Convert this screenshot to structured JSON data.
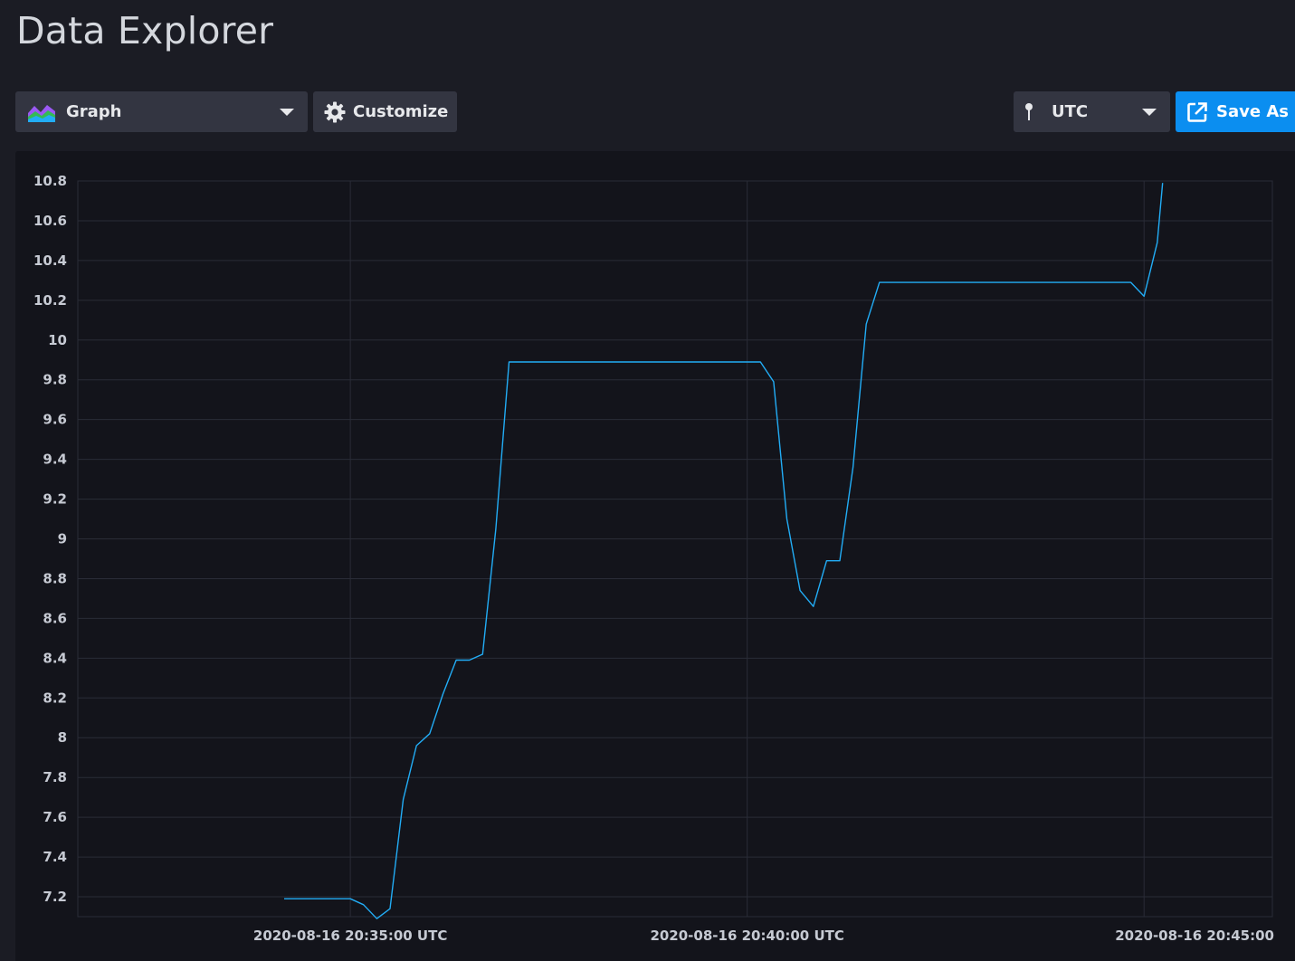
{
  "header": {
    "title": "Data Explorer"
  },
  "toolbar": {
    "visualization_label": "Graph",
    "visualization_icon": "graph-icon",
    "customize_label": "Customize",
    "customize_icon": "gear-icon",
    "timezone_label": "UTC",
    "timezone_icon": "pin-icon",
    "save_label": "Save As",
    "save_icon": "external-link-icon"
  },
  "colors": {
    "background": "#1b1c24",
    "panel": "#13141b",
    "button": "#333541",
    "accent": "#0b8ef0",
    "series": "#22adf6",
    "grid": "#2a2c37"
  },
  "chart_data": {
    "type": "line",
    "title": "",
    "xlabel": "",
    "ylabel": "",
    "ylim": [
      7.1,
      10.8
    ],
    "y_ticks": [
      "7.2",
      "7.4",
      "7.6",
      "7.8",
      "8",
      "8.2",
      "8.4",
      "8.6",
      "8.8",
      "9",
      "9.2",
      "9.4",
      "9.6",
      "9.8",
      "10",
      "10.2",
      "10.4",
      "10.6",
      "10.8"
    ],
    "xlim": [
      "2020-08-16T20:31:34Z",
      "2020-08-16T20:46:37Z"
    ],
    "x_ticks": [
      {
        "time": "2020-08-16T20:35:00Z",
        "label": "2020-08-16 20:35:00 UTC"
      },
      {
        "time": "2020-08-16T20:40:00Z",
        "label": "2020-08-16 20:40:00 UTC"
      },
      {
        "time": "2020-08-16T20:45:00Z",
        "label": "2020-08-16 20:45:00"
      }
    ],
    "grid": true,
    "series": [
      {
        "color": "#22adf6",
        "points": [
          [
            "2020-08-16T20:34:10Z",
            7.19
          ],
          [
            "2020-08-16T20:35:00Z",
            7.19
          ],
          [
            "2020-08-16T20:35:10Z",
            7.16
          ],
          [
            "2020-08-16T20:35:20Z",
            7.09
          ],
          [
            "2020-08-16T20:35:30Z",
            7.14
          ],
          [
            "2020-08-16T20:35:40Z",
            7.69
          ],
          [
            "2020-08-16T20:35:50Z",
            7.96
          ],
          [
            "2020-08-16T20:36:00Z",
            8.02
          ],
          [
            "2020-08-16T20:36:10Z",
            8.22
          ],
          [
            "2020-08-16T20:36:20Z",
            8.39
          ],
          [
            "2020-08-16T20:36:30Z",
            8.39
          ],
          [
            "2020-08-16T20:36:40Z",
            8.42
          ],
          [
            "2020-08-16T20:36:50Z",
            9.05
          ],
          [
            "2020-08-16T20:37:00Z",
            9.89
          ],
          [
            "2020-08-16T20:40:10Z",
            9.89
          ],
          [
            "2020-08-16T20:40:20Z",
            9.79
          ],
          [
            "2020-08-16T20:40:30Z",
            9.1
          ],
          [
            "2020-08-16T20:40:40Z",
            8.74
          ],
          [
            "2020-08-16T20:40:50Z",
            8.66
          ],
          [
            "2020-08-16T20:41:00Z",
            8.89
          ],
          [
            "2020-08-16T20:41:10Z",
            8.89
          ],
          [
            "2020-08-16T20:41:20Z",
            9.36
          ],
          [
            "2020-08-16T20:41:30Z",
            10.08
          ],
          [
            "2020-08-16T20:41:40Z",
            10.29
          ],
          [
            "2020-08-16T20:44:50Z",
            10.29
          ],
          [
            "2020-08-16T20:45:00Z",
            10.22
          ],
          [
            "2020-08-16T20:45:10Z",
            10.49
          ],
          [
            "2020-08-16T20:45:14Z",
            10.79
          ]
        ]
      }
    ]
  }
}
